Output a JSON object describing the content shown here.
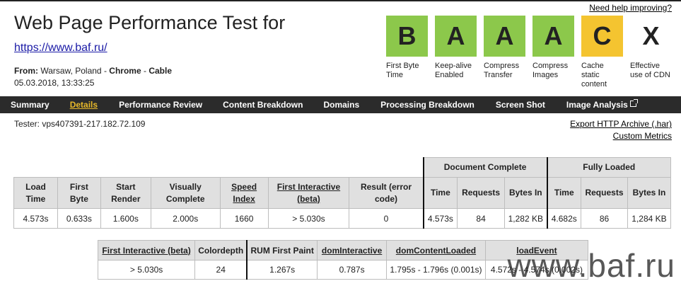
{
  "header": {
    "help_link": "Need help improving?",
    "title": "Web Page Performance Test for",
    "url": "https://www.baf.ru/",
    "from_label": "From:",
    "location": "Warsaw, Poland",
    "browser": "Chrome",
    "connection": "Cable",
    "sep": "-",
    "date": "05.03.2018, 13:33:25"
  },
  "grades": [
    {
      "grade": "B",
      "label": "First Byte Time",
      "color": "#8cc84b"
    },
    {
      "grade": "A",
      "label": "Keep-alive Enabled",
      "color": "#8cc84b"
    },
    {
      "grade": "A",
      "label": "Compress Transfer",
      "color": "#8cc84b"
    },
    {
      "grade": "A",
      "label": "Compress Images",
      "color": "#8cc84b"
    },
    {
      "grade": "C",
      "label": "Cache static content",
      "color": "#f4c430"
    },
    {
      "grade": "X",
      "label": "Effective use of CDN",
      "color": "#ffffff"
    }
  ],
  "nav": {
    "items": [
      "Summary",
      "Details",
      "Performance Review",
      "Content Breakdown",
      "Domains",
      "Processing Breakdown",
      "Screen Shot",
      "Image Analysis"
    ],
    "active": "Details",
    "external_icon": "external-link-icon"
  },
  "tester": "Tester: vps407391-217.182.72.109",
  "links": {
    "export": "Export HTTP Archive (.har)",
    "custom": "Custom Metrics"
  },
  "main_table": {
    "groups": {
      "document_complete": "Document Complete",
      "fully_loaded": "Fully Loaded"
    },
    "headers": {
      "load_time": "Load Time",
      "first_byte": "First Byte",
      "start_render": "Start Render",
      "visually_complete": "Visually Complete",
      "speed_index": "Speed Index",
      "first_interactive": "First Interactive (beta)",
      "result": "Result (error code)",
      "dc_time": "Time",
      "dc_requests": "Requests",
      "dc_bytes": "Bytes In",
      "fl_time": "Time",
      "fl_requests": "Requests",
      "fl_bytes": "Bytes In"
    },
    "row": {
      "load_time": "4.573s",
      "first_byte": "0.633s",
      "start_render": "1.600s",
      "visually_complete": "2.000s",
      "speed_index": "1660",
      "first_interactive": "> 5.030s",
      "result": "0",
      "dc_time": "4.573s",
      "dc_requests": "84",
      "dc_bytes": "1,282 KB",
      "fl_time": "4.682s",
      "fl_requests": "86",
      "fl_bytes": "1,284 KB"
    }
  },
  "second_table": {
    "headers": [
      "First Interactive (beta)",
      "Colordepth",
      "RUM First Paint",
      "domInteractive",
      "domContentLoaded",
      "loadEvent"
    ],
    "row": [
      "> 5.030s",
      "24",
      "1.267s",
      "0.787s",
      "1.795s - 1.796s (0.001s)",
      "4.572s - 4.574s (0.002s)"
    ]
  },
  "watermark": "www.baf.ru"
}
